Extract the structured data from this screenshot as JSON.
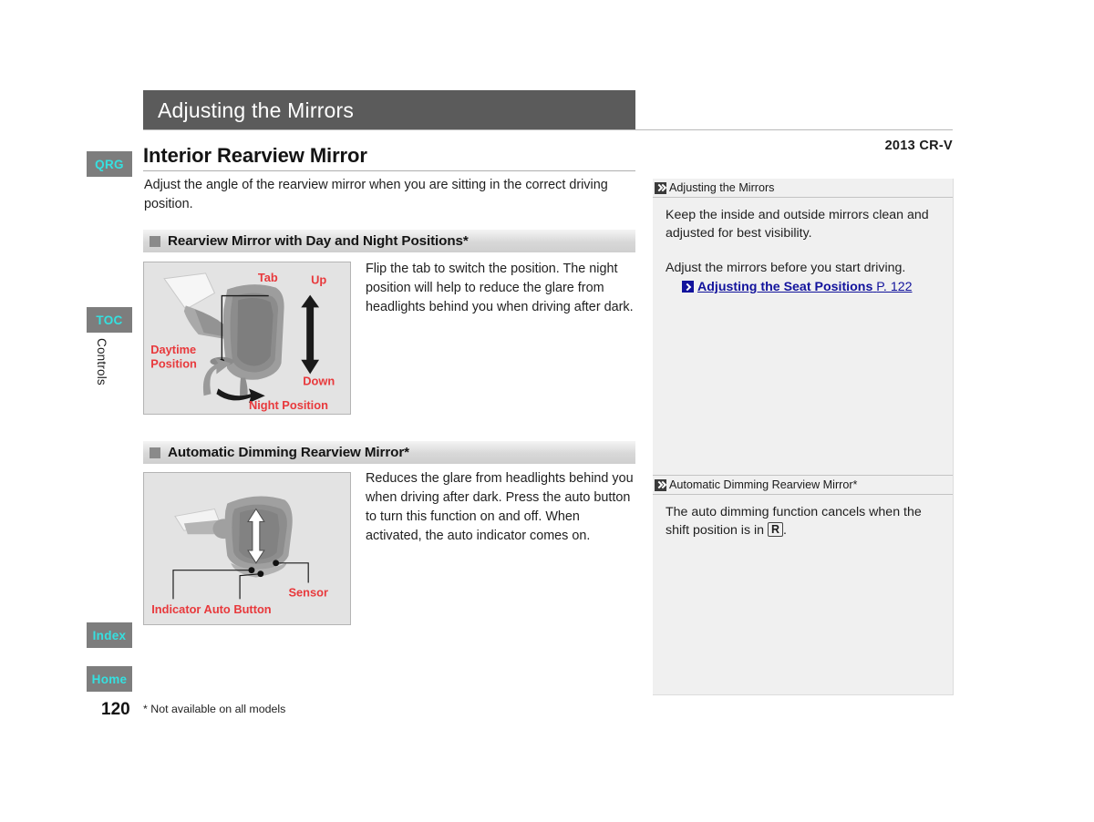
{
  "document": {
    "title": "Adjusting the Mirrors",
    "model": "2013 CR-V",
    "page_number": "120",
    "footnote": "* Not available on all models",
    "chapter": "Controls"
  },
  "sidebar_tabs": [
    {
      "label": "QRG"
    },
    {
      "label": "TOC"
    },
    {
      "label": "Index"
    },
    {
      "label": "Home"
    }
  ],
  "main": {
    "heading": "Interior Rearview Mirror",
    "intro": "Adjust the angle of the rearview mirror when you are sitting in the correct driving position.",
    "sections": [
      {
        "heading": "Rearview Mirror with Day and Night Positions*",
        "body": "Flip the tab to switch the position. The night position will help to reduce the glare from headlights behind you when driving after dark.",
        "figure_labels": {
          "tab": "Tab",
          "up": "Up",
          "down": "Down",
          "daytime_line1": "Daytime",
          "daytime_line2": "Position",
          "night": "Night Position"
        }
      },
      {
        "heading": "Automatic Dimming Rearview Mirror*",
        "body": "Reduces the glare from headlights behind you when driving after dark. Press the auto button to turn this function on and off. When activated, the auto indicator comes on.",
        "figure_labels": {
          "indicator": "Indicator",
          "auto_button": "Auto Button",
          "sensor": "Sensor"
        }
      }
    ]
  },
  "info_panel": {
    "blocks": [
      {
        "heading": "Adjusting the Mirrors",
        "paragraph1": "Keep the inside and outside mirrors clean and adjusted for best visibility.",
        "paragraph2": "Adjust the mirrors before you start driving.",
        "xref_title": "Adjusting the Seat Positions",
        "xref_page": "P. 122"
      },
      {
        "heading": "Automatic Dimming Rearview Mirror*",
        "paragraph1_pre": "The auto dimming function cancels when the shift position is in ",
        "gear": "R",
        "paragraph1_post": "."
      }
    ]
  },
  "colors": {
    "title_bar": "#5b5b5b",
    "tab_bg": "#7d7d7d",
    "tab_text": "#35e0e0",
    "figure_label": "#e8393c",
    "xref_blue": "#12139c",
    "panel_bg": "#f0f0f0"
  }
}
